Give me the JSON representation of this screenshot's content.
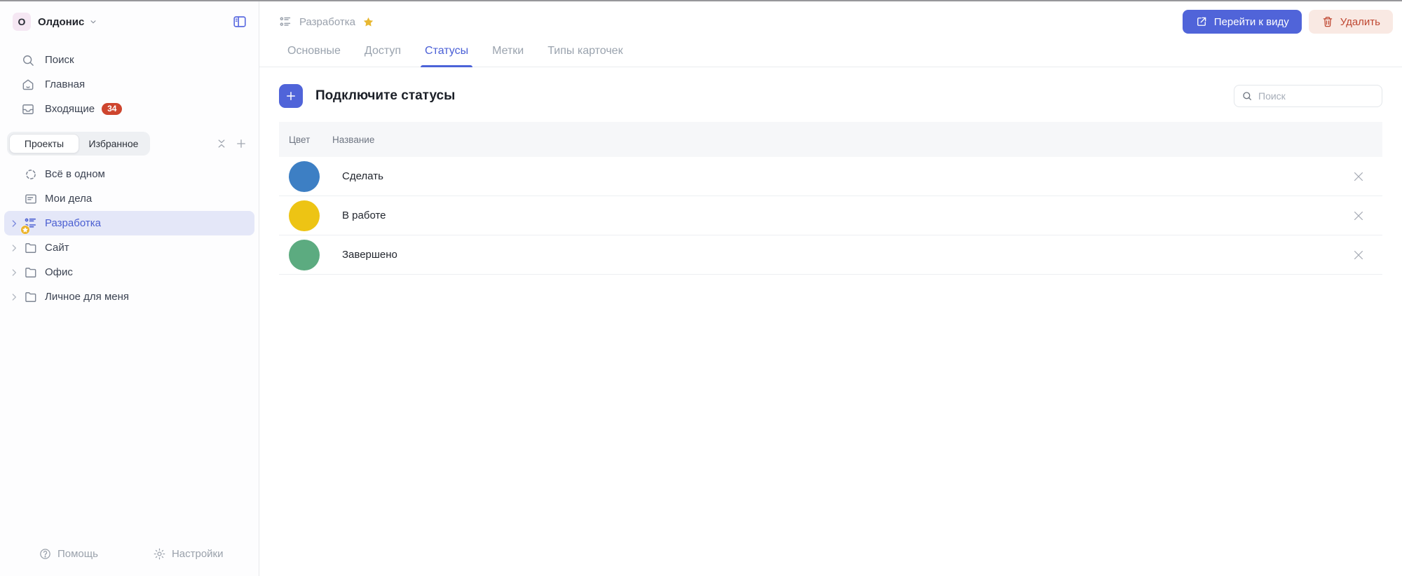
{
  "workspace": {
    "initial": "О",
    "name": "Олдонис"
  },
  "sidebar": {
    "nav": [
      {
        "label": "Поиск",
        "icon": "search-icon"
      },
      {
        "label": "Главная",
        "icon": "home-icon"
      },
      {
        "label": "Входящие",
        "icon": "inbox-icon",
        "badge": "34"
      }
    ],
    "tabs": [
      {
        "label": "Проекты",
        "active": true
      },
      {
        "label": "Избранное",
        "active": false
      }
    ],
    "projects": [
      {
        "label": "Всё в одном",
        "icon": "all-in-one-icon",
        "chevron": false,
        "selected": false,
        "starred": false
      },
      {
        "label": "Мои дела",
        "icon": "my-tasks-icon",
        "chevron": false,
        "selected": false,
        "starred": false
      },
      {
        "label": "Разработка",
        "icon": "project-list-icon",
        "chevron": true,
        "selected": true,
        "starred": true
      },
      {
        "label": "Сайт",
        "icon": "folder-icon",
        "chevron": true,
        "selected": false,
        "starred": false
      },
      {
        "label": "Офис",
        "icon": "folder-icon",
        "chevron": true,
        "selected": false,
        "starred": false
      },
      {
        "label": "Личное для меня",
        "icon": "folder-icon",
        "chevron": true,
        "selected": false,
        "starred": false
      }
    ],
    "footer": [
      {
        "label": "Помощь",
        "icon": "help-icon"
      },
      {
        "label": "Настройки",
        "icon": "gear-icon"
      }
    ]
  },
  "header": {
    "breadcrumb": "Разработка",
    "goto_view_label": "Перейти к виду",
    "delete_label": "Удалить"
  },
  "main_tabs": [
    {
      "label": "Основные",
      "active": false
    },
    {
      "label": "Доступ",
      "active": false
    },
    {
      "label": "Статусы",
      "active": true
    },
    {
      "label": "Метки",
      "active": false
    },
    {
      "label": "Типы карточек",
      "active": false
    }
  ],
  "content": {
    "title": "Подключите статусы",
    "search_placeholder": "Поиск",
    "table": {
      "columns": [
        "Цвет",
        "Название"
      ],
      "rows": [
        {
          "name": "Сделать",
          "color": "#3d7fc4"
        },
        {
          "name": "В работе",
          "color": "#edc414"
        },
        {
          "name": "Завершено",
          "color": "#5cab80"
        }
      ]
    }
  },
  "colors": {
    "accent": "#5064d9",
    "selected_item_bg": "#e4e7f8",
    "selected_item_text": "#4a5ed1",
    "active_tab": "#4a5fd6",
    "badge_red": "#ce452e",
    "danger_bg": "#f9e9e3",
    "danger_text": "#bf4731",
    "star_gold": "#e8b832"
  }
}
